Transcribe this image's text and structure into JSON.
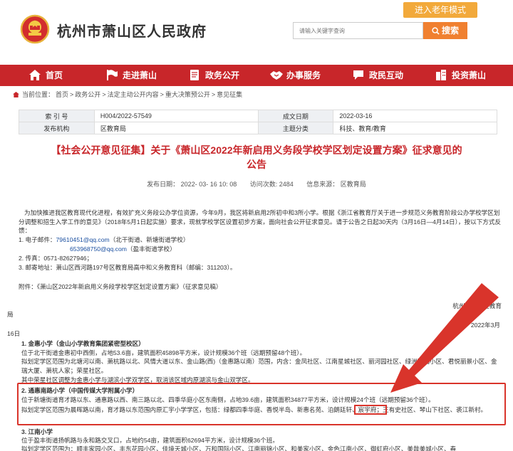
{
  "header": {
    "site_title": "杭州市萧山区人民政府",
    "elder_mode": "进入老年模式",
    "search_placeholder": "请输入关键字查询",
    "search_button": "搜索"
  },
  "nav": {
    "items": [
      {
        "label": "首页",
        "icon": "home-icon"
      },
      {
        "label": "走进萧山",
        "icon": "flag-icon"
      },
      {
        "label": "政务公开",
        "icon": "document-icon"
      },
      {
        "label": "办事服务",
        "icon": "handshake-icon"
      },
      {
        "label": "政民互动",
        "icon": "chat-icon"
      },
      {
        "label": "投资萧山",
        "icon": "building-icon"
      }
    ]
  },
  "breadcrumb": {
    "label": "当前位置：",
    "items": [
      "首页",
      "政务公开",
      "法定主动公开内容",
      "重大决策预公开",
      "意见征集"
    ],
    "separator": ">"
  },
  "info": {
    "rows": [
      {
        "l1": "索 引 号",
        "v1": "H004/2022-57549",
        "l2": "成文日期",
        "v2": "2022-03-16"
      },
      {
        "l1": "发布机构",
        "v1": "区教育局",
        "l2": "主题分类",
        "v2": "科技、教育/教育"
      }
    ]
  },
  "document": {
    "title_line1": "【社会公开意见征集】关于《萧山区2022年新启用义务段学校学区划定设置方案》征求意见的",
    "title_line2": "公告",
    "publish_time": "发布日期： 2022- 03- 16 10: 08",
    "views": "访问次数: 2484",
    "source": "信息来源： 区教育局"
  },
  "content": {
    "p1": "为加快推进我区教育现代化进程，有效扩充义务段公办学位资源，今年9月，我区将新启用2所初中和3所小学。根据《浙江省教育厅关于进一步规范义务教育阶段公办学校学区划分调整和招生入学工作的意见》（2018年5月1日起实施）要求，现就学校学区设置初步方案，面向社会公开征求意见。请于公告之日起30天内（3月16日—4月14日），按以下方式反馈：",
    "c1_prefix": "1. 电子邮件：",
    "c1_email": "79610451@qq.com",
    "c1_suffix": "（北干街道、新塘街道学校）",
    "c1b_email": "653968750@qq.com",
    "c1b_suffix": "（盈丰街道学校）",
    "c2": "2. 传真：0571-82627946；",
    "c3": "3. 邮寄地址：萧山区西河路197号区教育局高中和义务教育科（邮编：311203）。",
    "attachment": "附件：《萧山区2022年新启用义务段学校学区划定设置方案》（征求意见稿）",
    "sign_org": "杭州市萧山区教育",
    "sign_ju": "局",
    "sign_date": "2022年3月",
    "sign_day": "16日",
    "s1_title": "1. 金惠小学（金山小学教育集团紧密型校区）",
    "s1_a": "位于北干街道金惠初中西侧，占地53.6亩，建筑面积45898平方米，设计规模36个班（远期预留48个班）。",
    "s1_b": "拟划定学区范围为北塘河以南、萧杭路以北、风情大道以东、金山路(西)（金惠路以南）范围，内含：金凤社区、江南星城社区、丽河园社区、绿洲嘉园小区、君悦丽景小区、金瑞大厦、萧杭人家；荣星社区。",
    "s1_c": "其中荣星社区调整为金惠小学与湖滨小学双学区，取消该区域内原湖滨与金山双学区。",
    "s2_title": "2. 通惠南路小学（中国传媒大学附属小学）",
    "s2_a": "位于新塘街道育才路以东、通惠路以西、南三路以北、四季华庭小区东南侧，占地39.6亩，建筑面积34877平方米，设计规模24个班（远期预留36个班）。",
    "s2_b": "拟划定学区范围为晨晖路以南，育才路以东范围内原汇宇小学学区，包括：绿都四季华庭、香悦半岛、新惠名苑、泊朗廷轩、宸宇府；王有史社区、琴山下社区、裘江新村。",
    "s3_title": "3. 江南小学",
    "s3_a": "位于盈丰街道扬帆路与永和路交叉口，占地约54亩，建筑面积62694平方米，设计规模36个班。",
    "s3_b": "拟划定学区范围为：顺丰家园小区、丰东花园小区、佳境天城小区、万和国际小区、江南丽锦小区、和美家小区、金色江南小区、御虹府小区、美哉美城小区、春"
  },
  "colors": {
    "brand_red": "#c8262a",
    "elder_orange": "#f2a93b",
    "search_orange": "#f08030",
    "annotation_red": "#d9342b",
    "link_blue": "#1a4fa0"
  }
}
